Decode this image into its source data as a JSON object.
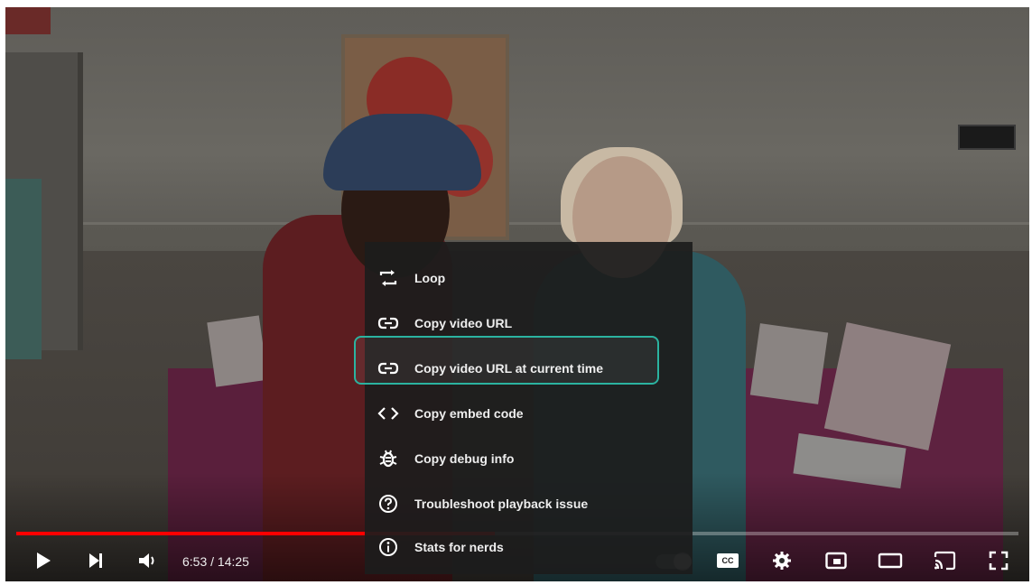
{
  "player": {
    "time_display": "6:53 / 14:25",
    "progress": 0.4776,
    "colors": {
      "progress": "#ff0000",
      "highlight": "#2bb3a0",
      "menu_bg": "#1c1c1c"
    }
  },
  "controls": {
    "play_icon": "play-icon",
    "next_icon": "next-icon",
    "volume_icon": "volume-icon",
    "cc_label": "CC",
    "settings_icon": "gear-icon",
    "miniplayer_icon": "miniplayer-icon",
    "theater_icon": "theater-icon",
    "cast_icon": "cast-icon",
    "fullscreen_icon": "fullscreen-icon"
  },
  "context_menu": {
    "items": [
      {
        "label": "Loop",
        "icon": "loop-icon"
      },
      {
        "label": "Copy video URL",
        "icon": "link-icon"
      },
      {
        "label": "Copy video URL at current time",
        "icon": "link-icon"
      },
      {
        "label": "Copy embed code",
        "icon": "code-icon"
      },
      {
        "label": "Copy debug info",
        "icon": "bug-icon"
      },
      {
        "label": "Troubleshoot playback issue",
        "icon": "help-icon"
      },
      {
        "label": "Stats for nerds",
        "icon": "info-icon"
      }
    ]
  }
}
